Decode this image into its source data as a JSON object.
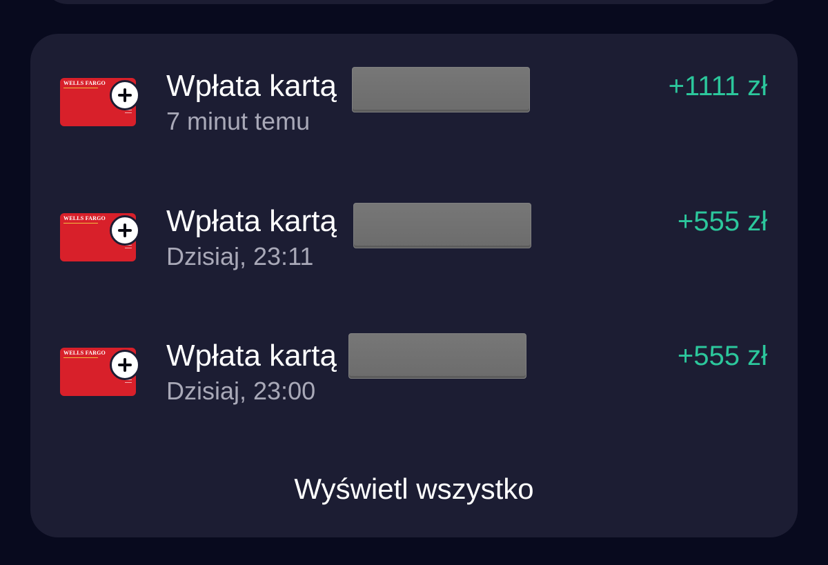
{
  "transactions": [
    {
      "title": "Wpłata kartą",
      "time": "7 minut temu",
      "amount": "+1111 zł",
      "card_brand": "WELLS FARGO",
      "card_icon": "credit-card-icon",
      "badge_icon": "plus-icon"
    },
    {
      "title": "Wpłata kartą",
      "time": "Dzisiaj, 23:11",
      "amount": "+555 zł",
      "card_brand": "WELLS FARGO",
      "card_icon": "credit-card-icon",
      "badge_icon": "plus-icon"
    },
    {
      "title": "Wpłata kartą",
      "time": "Dzisiaj, 23:00",
      "amount": "+555 zł",
      "card_brand": "WELLS FARGO",
      "card_icon": "credit-card-icon",
      "badge_icon": "plus-icon"
    }
  ],
  "view_all_label": "Wyświetl wszystko",
  "colors": {
    "background": "#080a1e",
    "panel": "#1c1d33",
    "amount_positive": "#2cc79c",
    "card_red": "#d8202a",
    "secondary_text": "#a9a9b8"
  }
}
